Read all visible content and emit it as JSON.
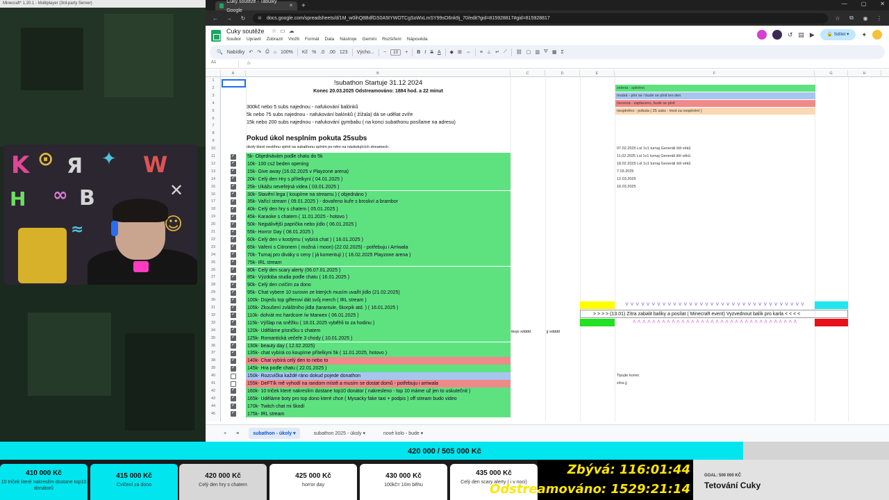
{
  "game": {
    "title": "Minecraft* 1.20.1 - Multiplayer (3rd-party Server)"
  },
  "browser": {
    "tab_title": "Cuky soutěže - Tabulky Google",
    "url": "docs.google.com/spreadsheets/d/1M_w0ihQ8BdfGS0A5tYWOTCgSoWxLmSY99sO6nk9j_70/edit?gid=815928817#gid=815928817"
  },
  "sheets": {
    "doc_title": "Cuky soutěže",
    "menus": [
      "Soubor",
      "Upravit",
      "Zobrazit",
      "Vložit",
      "Formát",
      "Data",
      "Nástroje",
      "Gemini",
      "Rozšíření",
      "Nápověda"
    ],
    "share_label": "Sdílet",
    "toolbar": {
      "search": "Nabídky",
      "zoom": "100%",
      "currency": "Kč",
      "percent": "%",
      "dec_down": ".0",
      "dec_up": ".00",
      "format": "123",
      "font": "Výcho...",
      "font_size": "10"
    },
    "name_box": "A1",
    "fx": "fx",
    "columns": [
      "A",
      "B",
      "C",
      "D",
      "E",
      "F",
      "G",
      "H"
    ],
    "title": "!subathon Startuje 31.12 2024",
    "subtitle": "Konec 20.03.2025   Odstreamováno: 1884 hod. a 22 minut",
    "rules": [
      "300kč nebo 5 subs najednou - nafukování balónků",
      "5k nebo 75 subs najednou - nafukování balónků ( žížala) dá se udělat zvíře",
      "15k nebo 200 subs najednou - nafukování gymbaliu ( na konci subathonu posílame na adresu)"
    ],
    "penalty_heading": "Pokud úkol nesplním pokuta 25subs",
    "penalty_note": "úkoly které nestihnu splnit na subathonu splním po něm na následujících streamech.",
    "legend": [
      {
        "label": "zelená - splněno",
        "color": "#5ee27f"
      },
      {
        "label": "modrá - plní se / bude se plnit ten den",
        "color": "#a7c6ee"
      },
      {
        "label": "červená - zaplaceno, bude se plnit",
        "color": "#f08a8a"
      },
      {
        "label": "nesplněno - pokuta ( 25 subs - trest za nesplnění )",
        "color": "#f9d8b3"
      }
    ],
    "side_notes": [
      {
        "row": 10,
        "text": "07.02.2025 Lol 1v1 turnaj Generáli štít věků"
      },
      {
        "row": 11,
        "text": "11.02.2025 Lol 1v1 turnaj Generáli štít věků"
      },
      {
        "row": 12,
        "text": "18.02.2025 Lol 1v1 turnaj Generáli štít věků"
      },
      {
        "row": 13,
        "text": "7.03.2025"
      },
      {
        "row": 14,
        "text": "12.03.2025"
      },
      {
        "row": 15,
        "text": "16.03.2025"
      },
      {
        "row": 40,
        "text": "Tipujte konec"
      },
      {
        "row": 41,
        "text": "zítra jj"
      }
    ],
    "tasks": [
      {
        "row": 11,
        "text": "5k- Objednávám podle chatu do 5k",
        "done": true,
        "color": "#5ee27f"
      },
      {
        "row": 12,
        "text": "10k- 100 cs2 beden opening",
        "done": true,
        "color": "#5ee27f"
      },
      {
        "row": 13,
        "text": "15k- Give away (16.02.2025 v Playzone arena)",
        "done": true,
        "color": "#5ee27f"
      },
      {
        "row": 14,
        "text": "20k- Celý den Hry s přítelkyní ( 04.01.2025 )",
        "done": true,
        "color": "#5ee27f"
      },
      {
        "row": 15,
        "text": "25k- Ukážu neveřejná videa ( 03.01.2025 )",
        "done": true,
        "color": "#5ee27f"
      },
      {
        "row": 16,
        "text": "30k- Stavění lega ( koupíme na streamu ) ( objednáno )",
        "done": true,
        "color": "#5ee27f"
      },
      {
        "row": 17,
        "text": "35k- Vařící stream ( 09.01.2025 ) - dovařeno kuře s broskví a brambor",
        "done": true,
        "color": "#5ee27f"
      },
      {
        "row": 18,
        "text": "40k- Celý den hry s chatem ( 05.01.2025 )",
        "done": true,
        "color": "#5ee27f"
      },
      {
        "row": 19,
        "text": "45k- Karaoke s chatem ( 11.01.2025 - hotovo )",
        "done": true,
        "color": "#5ee27f"
      },
      {
        "row": 20,
        "text": "50k- Nejpálivější paprička nebo jídlo ( 06.01.2025 )",
        "done": true,
        "color": "#5ee27f"
      },
      {
        "row": 21,
        "text": "55k- Horror Day ( 08.01.2025 )",
        "done": true,
        "color": "#5ee27f"
      },
      {
        "row": 22,
        "text": "60k- Celý den v kostýmu ( vybírá chat ) ( 16.01.2025 )",
        "done": true,
        "color": "#5ee27f"
      },
      {
        "row": 23,
        "text": "65k- Vaření s Citronem ( možná i moon) (22.02.2025) - potřebuju i Arriwala",
        "done": true,
        "color": "#5ee27f"
      },
      {
        "row": 24,
        "text": "70k- Turnaj pro diváky o ceny ( já komentuji ) ( 16.02.2025 Playzone arena )",
        "done": true,
        "color": "#5ee27f"
      },
      {
        "row": 25,
        "text": "75k- IRL stream",
        "done": true,
        "color": "#5ee27f"
      },
      {
        "row": 26,
        "text": "80k- Celý den scary alerty (06.07.01.2025 )",
        "done": true,
        "color": "#5ee27f"
      },
      {
        "row": 27,
        "text": "85k- Výzdoba studia podle chatu ( 16.01.2025 )",
        "done": true,
        "color": "#5ee27f"
      },
      {
        "row": 28,
        "text": "90k- Celý den cvičím za dono",
        "done": true,
        "color": "#5ee27f"
      },
      {
        "row": 29,
        "text": "95k- Chat vybere 10 surovin ze kterých musím uvařit jídlo (21.02.2025)",
        "done": true,
        "color": "#5ee27f"
      },
      {
        "row": 30,
        "text": "100k- Dojedu top gifterovi dát svůj merch ( IRL stream )",
        "done": true,
        "color": "#5ee27f"
      },
      {
        "row": 31,
        "text": "105k- Zkoušení zvláštního jídla (tarantule, škorpik atd. ) ( 16.01.2025 )",
        "done": true,
        "color": "#5ee27f"
      },
      {
        "row": 32,
        "text": "110k- dohrát mc hardcore /w Marwex ( 06.01.2025 )",
        "done": true,
        "color": "#5ee27f"
      },
      {
        "row": 33,
        "text": "115k- Výšlap na sněžku ( 18.01.2025 vyběhli to za hodinu )",
        "done": true,
        "color": "#5ee27f"
      },
      {
        "row": 34,
        "text": "120k- Udělámе písničku s chatem",
        "done": true,
        "color": "#5ee27f"
      },
      {
        "row": 35,
        "text": "125k- Romantická večeře 3 chody ( 10.01.2025 )",
        "done": true,
        "color": "#5ee27f"
      },
      {
        "row": 36,
        "text": "130k- beauty day ( 12.02.2025)",
        "done": true,
        "color": "#5ee27f"
      },
      {
        "row": 37,
        "text": "135k- chat vybírá co koupíme přítelkyni 5k ( 11.01.2025, hotovo )",
        "done": true,
        "color": "#5ee27f"
      },
      {
        "row": 38,
        "text": "140k- Chat vybírá celý den to nebo to",
        "done": true,
        "color": "#f08a8a"
      },
      {
        "row": 39,
        "text": "145k- Hra podle chatu ( 22.01.2025 )",
        "done": true,
        "color": "#5ee27f"
      },
      {
        "row": 40,
        "text": "150k- Rozcvička každé ráno dokud pojede donathon",
        "done": false,
        "color": "#a7c6ee"
      },
      {
        "row": 41,
        "text": "155k- DeFTík mě vyhodí na random místě a musím se dostat domů - potřebuju i arriwala",
        "done": false,
        "color": "#f08a8a"
      },
      {
        "row": 42,
        "text": "160k- 10 triček které nakreslím dostane top10 donátor ( nakresleno - top 10 máme už jen to uskutečnit )",
        "done": true,
        "color": "#5ee27f"
      },
      {
        "row": 43,
        "text": "165k- Uděláme boty pro top dono které chce ( Mysacky fake taxi + podpis ) off stream budo video",
        "done": true,
        "color": "#5ee27f"
      },
      {
        "row": 44,
        "text": "170k- Twitch chat mi škodí",
        "done": true,
        "color": "#5ee27f"
      },
      {
        "row": 45,
        "text": "175k- IRL stream",
        "done": true,
        "color": "#5ee27f"
      }
    ],
    "row33_c": "tkojo xdddd",
    "row33_d": "jj xdddd",
    "banner": {
      "arrows_top": "V V V V V V V V V V V V V V V V V V V V V V V V V V V V V V V V V V",
      "text": "> > > >  (13.01) Zítra zabalit balíky a posílat ( Minecraft event) Vyzvednout balík pro karla  < < < <",
      "arrows_bottom": "Λ Λ Λ Λ Λ Λ Λ Λ Λ Λ Λ Λ Λ Λ Λ Λ Λ Λ Λ Λ Λ Λ Λ Λ Λ Λ Λ Λ Λ Λ Λ Λ Λ Λ"
    },
    "sheet_tabs": [
      "subathon - úkoly",
      "subathon 2025 - úkoly",
      "nové kolo - bude"
    ]
  },
  "overlay": {
    "progress_text": "420 000 / 505 000 Kč",
    "progress_fraction": 0.836,
    "goals": [
      {
        "amount": "410 000 Kč",
        "label": "10 triček které nakreslím dostane top10 donátorů",
        "state": "done"
      },
      {
        "amount": "415 000 Kč",
        "label": "Cvičení za dono",
        "state": "done"
      },
      {
        "amount": "420 000 Kč",
        "label": "Celý den hry s chatem",
        "state": "current"
      },
      {
        "amount": "425 000 Kč",
        "label": "horror day",
        "state": "next"
      },
      {
        "amount": "430 000 Kč",
        "label": "100kč= 10m běhu",
        "state": "next"
      },
      {
        "amount": "435 000 Kč",
        "label": "Celý den scary alerty ( i v noci)",
        "state": "next"
      }
    ],
    "remaining": "Zbývá: 116:01:44",
    "streamed": "Odstreamováno: 1529:21:14",
    "goal_small": "GOAL: 500 000 KČ",
    "goal_big": "Tetování Cuky"
  }
}
